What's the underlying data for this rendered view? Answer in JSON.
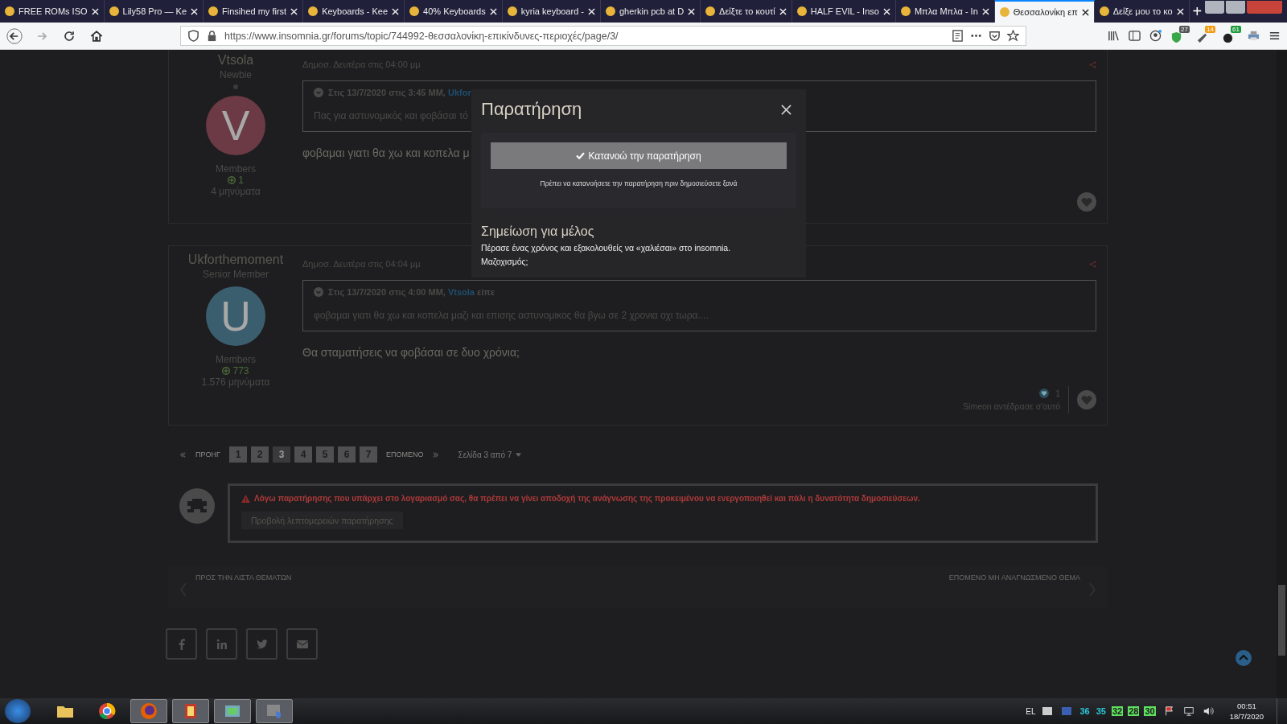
{
  "browser": {
    "tabs": [
      {
        "label": "FREE ROMs ISO",
        "selected": false
      },
      {
        "label": "Lily58 Pro — Ke",
        "selected": false
      },
      {
        "label": "Finsihed my first",
        "selected": false
      },
      {
        "label": "Keyboards - Kee",
        "selected": false
      },
      {
        "label": "40% Keyboards",
        "selected": false
      },
      {
        "label": "kyria keyboard -",
        "selected": false
      },
      {
        "label": "gherkin pcb at D",
        "selected": false
      },
      {
        "label": "Δείξτε το κουτί",
        "selected": false
      },
      {
        "label": "HALF EVIL - Inso",
        "selected": false
      },
      {
        "label": "Μπλα Μπλα - In",
        "selected": false
      },
      {
        "label": "Θεσσαλονίκη επ",
        "selected": true
      },
      {
        "label": "Δείξε μου το κο",
        "selected": false
      }
    ],
    "new_tab": "+",
    "url": "https://www.insomnia.gr/forums/topic/744992-θεσσαλονίκη-επικίνδυνες-περιοχές/page/3/",
    "extension_badges": [
      "27",
      "14",
      "61"
    ]
  },
  "posts": [
    {
      "author": "Vtsola",
      "rank": "Newbie",
      "initial": "V",
      "group": "Members",
      "reputation": "1",
      "post_count": "4 μηνύματα",
      "date": "Δημοσ. Δευτέρα στις 04:00 μμ",
      "quote_header": "Στις 13/7/2020 στις 3:45 ΜΜ, ",
      "quote_author": "Ukfor",
      "quote_text": "Πας για αστυνομικός και φοβάσαι τό",
      "body": "φοβαμαι γιατι θα χω και κοπελα μ"
    },
    {
      "author": "Ukforthemoment",
      "rank": "Senior Member",
      "initial": "U",
      "group": "Members",
      "reputation": "773",
      "post_count": "1.576 μηνύματα",
      "date": "Δημοσ. Δευτέρα στις 04:04 μμ",
      "quote_header": "Στις 13/7/2020 στις 4:00 ΜΜ, ",
      "quote_author": "Vtsola",
      "quote_suffix": " είπε",
      "quote_text": "φοβαμαι γιατι θα χω και κοπελα μαζι και επισης αστυνομικος θα βγω σε 2 χρονια οχι τωρα....",
      "body": "Θα σταματήσεις να φοβάσαι σε δυο χρόνια;",
      "reaction_count": "1",
      "reaction_text": "Simeon αντέδρασε σ'αυτό"
    }
  ],
  "pagination": {
    "prev": "ΠΡΟΗΓ",
    "pages": [
      {
        "label": "1",
        "selected": false
      },
      {
        "label": "2",
        "selected": false
      },
      {
        "label": "3",
        "selected": true
      },
      {
        "label": "4",
        "selected": false
      },
      {
        "label": "5",
        "selected": false
      },
      {
        "label": "6",
        "selected": false
      },
      {
        "label": "7",
        "selected": false
      }
    ],
    "next": "ΕΠΟΜΕΝΟ",
    "page_of": "Σελίδα 3 από 7"
  },
  "warning": {
    "text": "Λόγω παρατήρησης που υπάρχει στο λογαριασμό σας, θα πρέπει να γίνει αποδοχή της ανάγνωσης της προκειμένου να ενεργοποιηθεί και πάλι η δυνατότητα δημοσιεύσεων.",
    "button": "Προβολή λεπτομερειών παρατήρησης"
  },
  "topic_nav": {
    "back": "ΠΡΟΣ ΤΗΝ ΛΙΣΤΑ ΘΕΜΑΤΩΝ",
    "next": "ΕΠΟΜΕΝΟ ΜΗ ΑΝΑΓΝΩΣΜΕΝΟ ΘΕΜΑ"
  },
  "modal": {
    "title": "Παρατήρηση",
    "acknowledge_button": "Κατανοώ την παρατήρηση",
    "hint": "Πρέπει να κατανοήσετε την παρατήρηση πριν δημοσιεύσετε ξανά",
    "note_title": "Σημείωση για μέλος",
    "note_lines": [
      "Πέρασε ένας χρόνος και εξακολουθείς να «χαλιέσαι» στο insomnia.",
      "Μαζοχισμός;"
    ]
  },
  "taskbar": {
    "language": "EL",
    "tray_numbers": [
      "36",
      "35",
      "32",
      "28",
      "30"
    ],
    "time": "00:51",
    "date": "18/7/2020"
  }
}
